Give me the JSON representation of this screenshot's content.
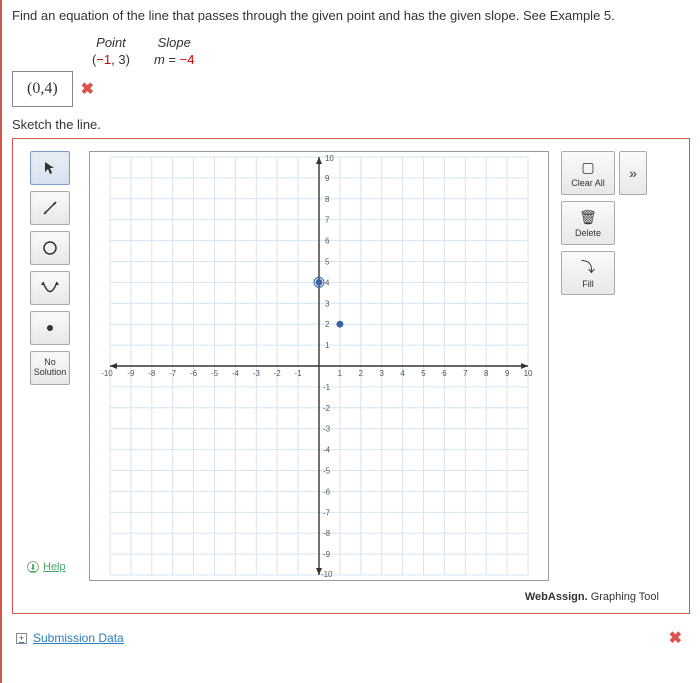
{
  "question": "Find an equation of the line that passes through the given point and has the given slope. See Example 5.",
  "given": {
    "point_header": "Point",
    "slope_header": "Slope",
    "point_value_pre": "(",
    "point_x": "−1",
    "point_rest": ", 3)",
    "slope_value": "m = −4"
  },
  "answer": {
    "value": "(0,4)",
    "mark_icon": "✖"
  },
  "sketch_label": "Sketch the line.",
  "tools": {
    "pointer": "↖",
    "line": "↗",
    "circle": "◯",
    "parabola": "∪",
    "point": "•",
    "no_solution": "No Solution"
  },
  "side": {
    "clear_all": "Clear All",
    "delete": "Delete",
    "fill": "Fill",
    "expand": "»"
  },
  "graph_caption_brand": "WebAssign.",
  "graph_caption_rest": " Graphing Tool",
  "help_label": "Help",
  "submission_label": "Submission Data",
  "bottom_mark": "✖",
  "chart_data": {
    "type": "scatter",
    "title": "",
    "xlabel": "",
    "ylabel": "",
    "xlim": [
      -10,
      10
    ],
    "ylim": [
      -10,
      10
    ],
    "x_ticks": [
      -10,
      -9,
      -8,
      -7,
      -6,
      -5,
      -4,
      -3,
      -2,
      -1,
      1,
      2,
      3,
      4,
      5,
      6,
      7,
      8,
      9,
      10
    ],
    "y_ticks": [
      -10,
      -9,
      -8,
      -7,
      -6,
      -5,
      -4,
      -3,
      -2,
      -1,
      1,
      2,
      3,
      4,
      5,
      6,
      7,
      8,
      9,
      10
    ],
    "grid": true,
    "series": [
      {
        "name": "plotted-points",
        "points": [
          [
            0,
            4
          ],
          [
            1,
            2
          ]
        ]
      }
    ]
  }
}
